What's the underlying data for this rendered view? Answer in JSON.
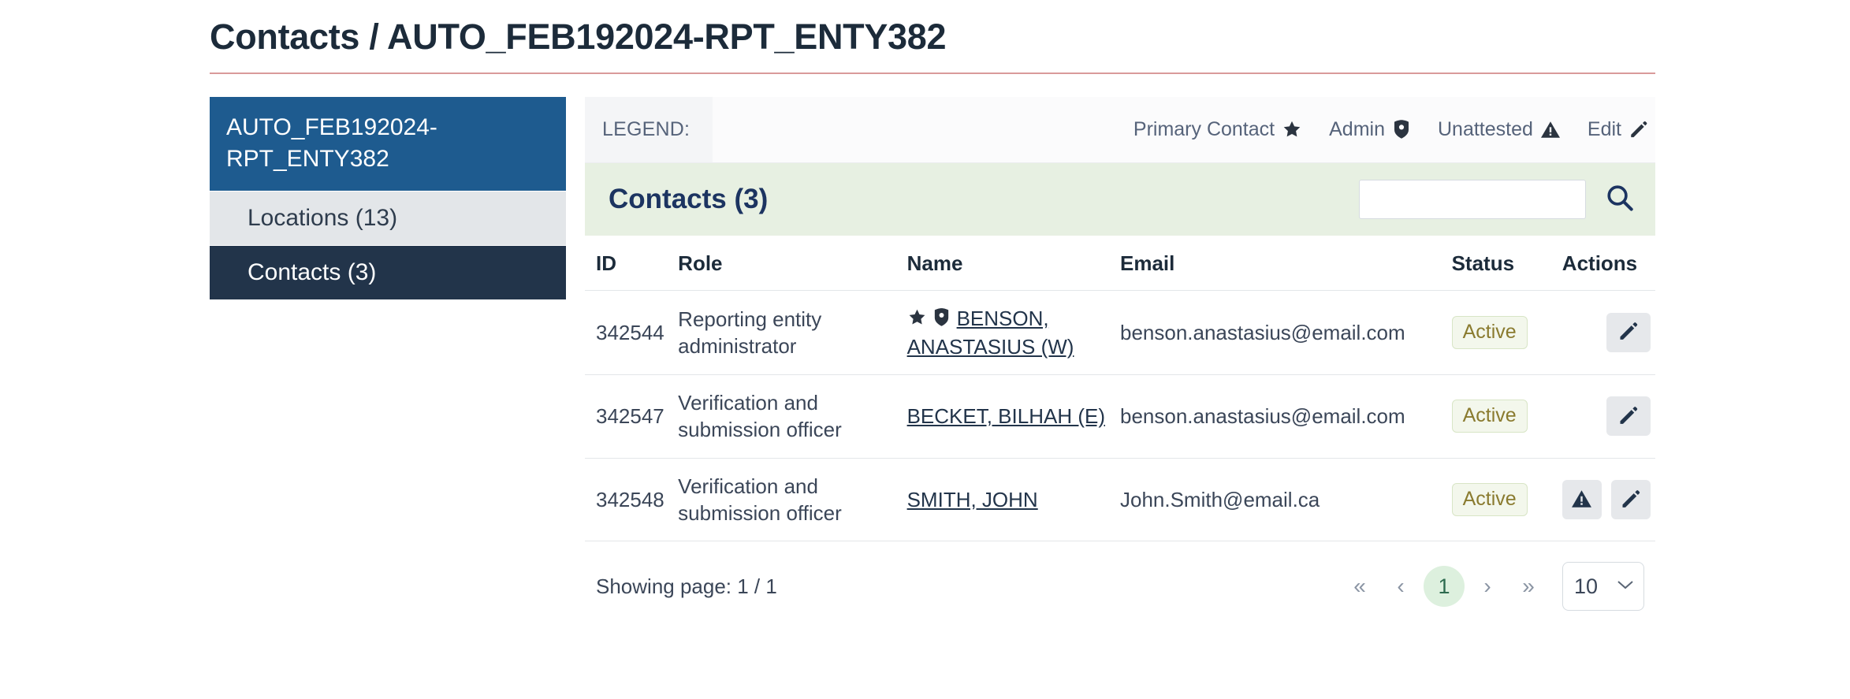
{
  "page": {
    "title": "Contacts / AUTO_FEB192024-RPT_ENTY382",
    "rule_color": "#d99a9a"
  },
  "sidebar": {
    "entity_name": "AUTO_FEB192024-RPT_ENTY382",
    "items": [
      {
        "label": "Locations (13)",
        "active": false
      },
      {
        "label": "Contacts (3)",
        "active": true
      }
    ],
    "active_color": "#22344a",
    "header_color": "#1e5b8f"
  },
  "legend": {
    "label": "LEGEND:",
    "items": [
      {
        "label": "Primary Contact",
        "icon": "star-icon"
      },
      {
        "label": "Admin",
        "icon": "shield-icon"
      },
      {
        "label": "Unattested",
        "icon": "warning-triangle-icon"
      },
      {
        "label": "Edit",
        "icon": "pencil-icon"
      }
    ]
  },
  "section": {
    "title": "Contacts (3)",
    "background": "#e7f0e2",
    "search": {
      "value": "",
      "placeholder": "",
      "button_icon": "search-icon"
    }
  },
  "table": {
    "columns": [
      "ID",
      "Role",
      "Name",
      "Email",
      "Status",
      "Actions"
    ],
    "rows": [
      {
        "id": "342544",
        "role": "Reporting entity administrator",
        "name": "BENSON, ANASTASIUS (W)",
        "name_icons": [
          "star-icon",
          "shield-icon"
        ],
        "email": "benson.anastasius@email.com",
        "status": "Active",
        "actions": [
          "pencil-icon"
        ]
      },
      {
        "id": "342547",
        "role": "Verification and submission officer",
        "name": "BECKET, BILHAH (E)",
        "name_icons": [],
        "email": "benson.anastasius@email.com",
        "status": "Active",
        "actions": [
          "pencil-icon"
        ]
      },
      {
        "id": "342548",
        "role": "Verification and submission officer",
        "name": "SMITH, JOHN",
        "name_icons": [],
        "email": "John.Smith@email.ca",
        "status": "Active",
        "actions": [
          "warning-triangle-icon",
          "pencil-icon"
        ]
      }
    ]
  },
  "footer": {
    "showing_page": "Showing page: 1 / 1",
    "pager": {
      "first": "«",
      "prev": "‹",
      "current": "1",
      "next": "›",
      "last": "»"
    },
    "per_page": "10"
  }
}
